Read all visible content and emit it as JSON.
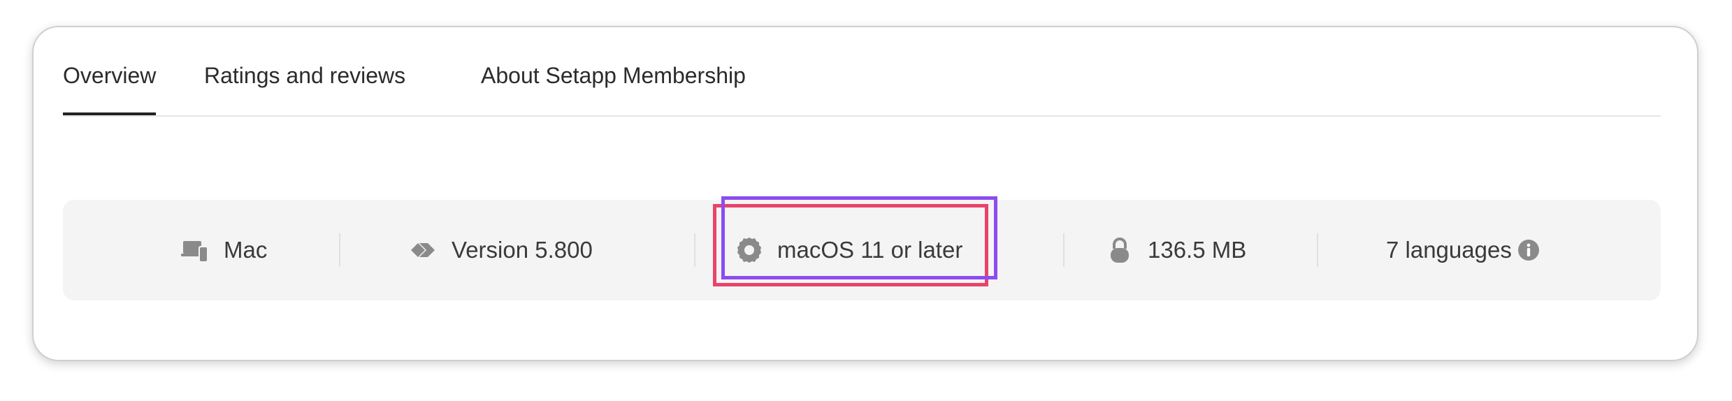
{
  "tabs": [
    {
      "label": "Overview",
      "active": true
    },
    {
      "label": "Ratings and reviews",
      "active": false
    },
    {
      "label": "About Setapp Membership",
      "active": false
    }
  ],
  "specs": {
    "platform": {
      "label": "Mac",
      "icon": "devices-icon"
    },
    "version": {
      "label": "Version 5.800",
      "icon": "version-tag-icon"
    },
    "os": {
      "label": "macOS 11 or later",
      "icon": "gear-icon"
    },
    "size": {
      "label": "136.5 MB",
      "icon": "lock-icon"
    },
    "languages": {
      "label": "7 languages",
      "icon": "info-icon"
    }
  },
  "colors": {
    "highlight_red": "#e8436b",
    "highlight_purple": "#8b4cf0",
    "icon_gray": "#8a8a8a",
    "text": "#2b2b2b"
  }
}
